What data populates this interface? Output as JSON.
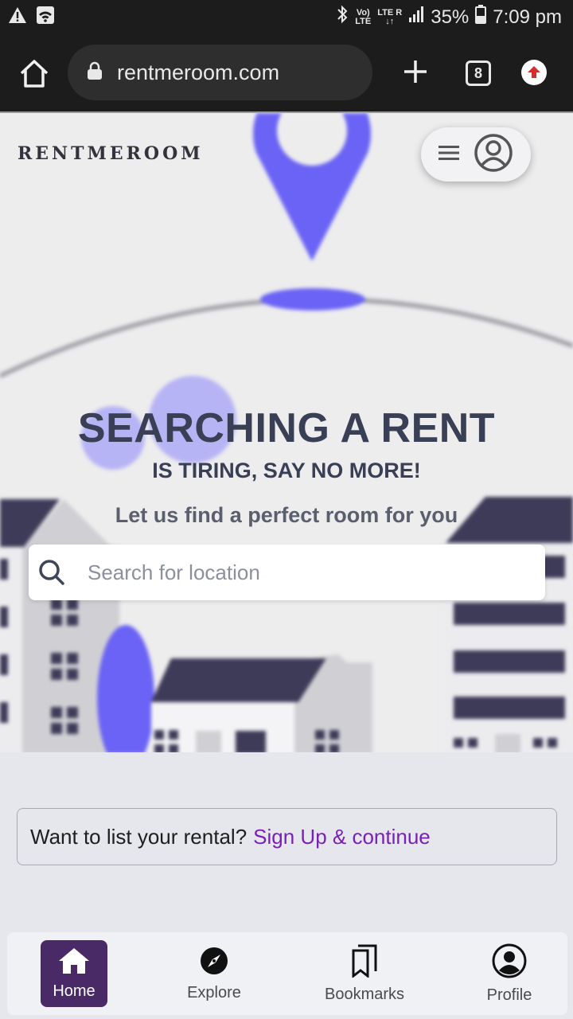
{
  "status_bar": {
    "network_top": "Vo)",
    "network_bottom": "LTE",
    "lte_label": "LTE",
    "roaming_label": "R",
    "battery": "35%",
    "time": "7:09 pm",
    "icons": [
      "warning-icon",
      "wifi-icon",
      "bluetooth-icon",
      "signal-icon",
      "battery-icon"
    ]
  },
  "browser": {
    "url": "rentmeroom.com",
    "tab_count": "8",
    "icons": [
      "home-icon",
      "lock-icon",
      "plus-icon",
      "update-icon"
    ]
  },
  "header": {
    "brand": "RENTMEROOM",
    "icons": [
      "hamburger-icon",
      "user-circle-icon"
    ]
  },
  "hero": {
    "headline": "SEARCHING A RENT",
    "subheadline": "IS TIRING, SAY NO MORE!",
    "tagline": "Let us find a perfect room for you"
  },
  "search": {
    "placeholder": "Search for location",
    "value": ""
  },
  "listing": {
    "prompt": "Want to list your rental?",
    "link": "Sign Up & continue"
  },
  "bottom_nav": {
    "items": [
      {
        "label": "Home",
        "icon": "home-icon",
        "active": true
      },
      {
        "label": "Explore",
        "icon": "compass-icon",
        "active": false
      },
      {
        "label": "Bookmarks",
        "icon": "bookmarks-icon",
        "active": false
      },
      {
        "label": "Profile",
        "icon": "profile-icon",
        "active": false
      }
    ]
  },
  "colors": {
    "accent": "#7a1fb8",
    "nav_active": "#4a2a66",
    "illustration_purple": "#6a63f5",
    "illustration_dark": "#3e3b58",
    "heading": "#394055"
  }
}
